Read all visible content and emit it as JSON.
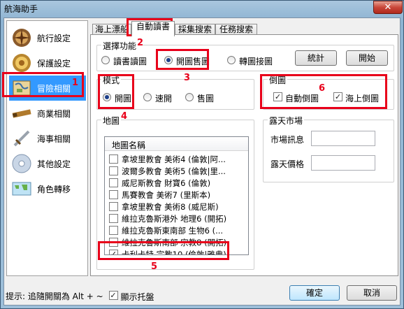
{
  "window": {
    "title": "航海助手",
    "close_glyph": "✕"
  },
  "sidebar": {
    "items": [
      {
        "label": "航行設定",
        "icon": "compass-icon",
        "selected": false
      },
      {
        "label": "保護設定",
        "icon": "shield-coin-icon",
        "selected": false
      },
      {
        "label": "冒險相關",
        "icon": "map-icon",
        "selected": true
      },
      {
        "label": "商業相關",
        "icon": "telescope-icon",
        "selected": false
      },
      {
        "label": "海事相關",
        "icon": "sword-icon",
        "selected": false
      },
      {
        "label": "其他設定",
        "icon": "disc-icon",
        "selected": false
      },
      {
        "label": "角色轉移",
        "icon": "world-map-icon",
        "selected": false
      }
    ]
  },
  "tabs": [
    {
      "label": "海上漂船",
      "active": false
    },
    {
      "label": "自動讀書",
      "active": true
    },
    {
      "label": "採集搜索",
      "active": false
    },
    {
      "label": "任務搜索",
      "active": false
    }
  ],
  "select_function": {
    "title": "選擇功能",
    "options": [
      {
        "label": "讀書讀圖",
        "selected": false
      },
      {
        "label": "開圖售圖",
        "selected": true
      },
      {
        "label": "轉圖接圖",
        "selected": false
      }
    ],
    "buttons": {
      "stats": "統計",
      "start": "開始"
    }
  },
  "mode": {
    "title": "模式",
    "options": [
      {
        "label": "開圖",
        "selected": true
      },
      {
        "label": "速開",
        "selected": false
      },
      {
        "label": "售圖",
        "selected": false
      }
    ]
  },
  "dump_map": {
    "title": "倒圖",
    "options": [
      {
        "label": "自動倒圖",
        "checked": true
      },
      {
        "label": "海上倒圖",
        "checked": true
      }
    ]
  },
  "map_list": {
    "title": "地圖",
    "column_header": "地圖名稱",
    "rows": [
      {
        "name": "拿坡里教會 美術4 (倫敦|阿...",
        "checked": false
      },
      {
        "name": "波爾多教會 美術5 (倫敦|里...",
        "checked": false
      },
      {
        "name": "威尼斯教會 財寶6 (倫敦)",
        "checked": false
      },
      {
        "name": "馬賽教會 美術7 (里斯本)",
        "checked": false
      },
      {
        "name": "拿坡里教會 美術8 (威尼斯)",
        "checked": false
      },
      {
        "name": "維拉克魯斯港外 地理6 (開拓)",
        "checked": false
      },
      {
        "name": "維拉克魯斯東南部 生物6 (...",
        "checked": false
      },
      {
        "name": "維拉克魯斯南部 宗教8 (開拓)",
        "checked": false
      },
      {
        "name": "卡利卡特 宗教10 (倫敦|雅典)",
        "checked": true
      }
    ]
  },
  "open_market": {
    "title": "露天市場",
    "market_info_label": "市場訊息",
    "market_info_value": "",
    "price_label": "露天價格",
    "price_value": ""
  },
  "status": {
    "hint": "提示: 追隨開關為 Alt + ~",
    "show_tray_label": "顯示托盤",
    "show_tray_checked": true
  },
  "footer": {
    "ok": "確定",
    "cancel": "取消"
  },
  "annotations": [
    "1",
    "2",
    "3",
    "4",
    "5",
    "6"
  ],
  "colors": {
    "annotation_red": "#e8001a",
    "selected_blue": "#3399ff"
  }
}
